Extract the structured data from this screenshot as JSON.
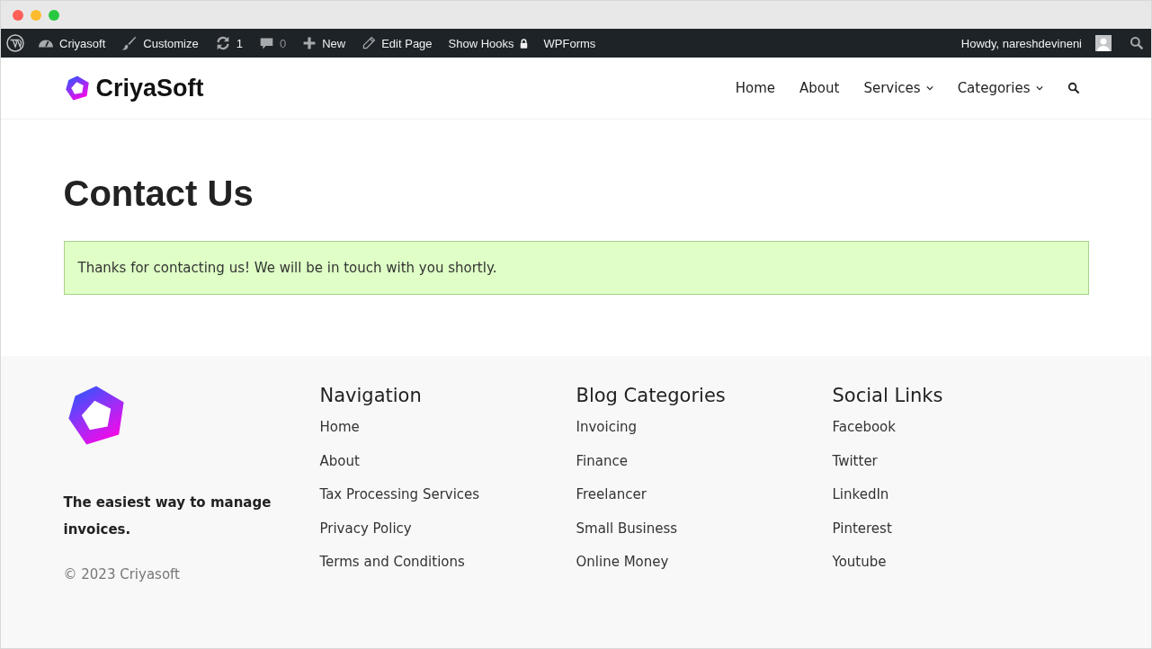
{
  "admin_bar": {
    "items": [
      {
        "kind": "wp"
      },
      {
        "kind": "site",
        "label": "Criyasoft"
      },
      {
        "kind": "customize",
        "label": "Customize"
      },
      {
        "kind": "updates",
        "label": "1"
      },
      {
        "kind": "comments",
        "label": "0",
        "disabled": true
      },
      {
        "kind": "new",
        "label": "New"
      },
      {
        "kind": "edit",
        "label": "Edit Page"
      },
      {
        "kind": "hooks",
        "label": "Show Hooks"
      },
      {
        "kind": "link",
        "label": "WPForms"
      }
    ],
    "user": {
      "label": "Howdy, nareshdevineni"
    }
  },
  "header": {
    "logo_text": "CriyaSoft",
    "nav": [
      {
        "label": "Home",
        "dropdown": false
      },
      {
        "label": "About",
        "dropdown": false
      },
      {
        "label": "Services",
        "dropdown": true
      },
      {
        "label": "Categories",
        "dropdown": true
      }
    ]
  },
  "page": {
    "title": "Contact Us",
    "notice": "Thanks for contacting us! We will be in touch with you shortly."
  },
  "footer": {
    "tagline": "The easiest way to manage invoices.",
    "copyright": "© 2023 Criyasoft",
    "columns": [
      {
        "heading": "Navigation",
        "links": [
          "Home",
          "About",
          "Tax Processing Services",
          "Privacy Policy",
          "Terms and Conditions"
        ]
      },
      {
        "heading": "Blog Categories",
        "links": [
          "Invoicing",
          "Finance",
          "Freelancer",
          "Small Business",
          "Online Money"
        ]
      },
      {
        "heading": "Social Links",
        "links": [
          "Facebook",
          "Twitter",
          "LinkedIn",
          "Pinterest",
          "Youtube"
        ]
      }
    ]
  }
}
